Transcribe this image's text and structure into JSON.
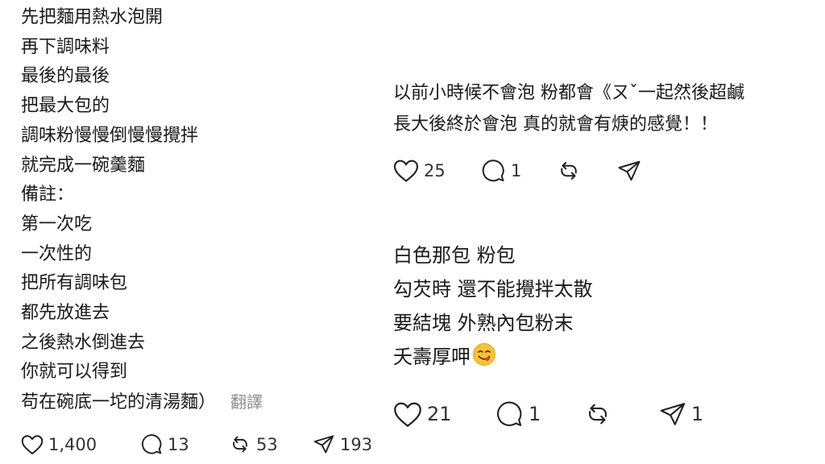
{
  "left_post": {
    "lines": [
      "先把麵用熱水泡開",
      "再下調味料",
      "最後的最後",
      "把最大包的",
      "調味粉慢慢倒慢慢攪拌",
      "就完成一碗羹麵",
      "備註：",
      "第一次吃",
      "一次性的",
      "把所有調味包",
      "都先放進去",
      "之後熱水倒進去",
      "你就可以得到",
      "苟在碗底一坨的清湯麵）"
    ],
    "translate_label": "翻譯",
    "likes": "1,400",
    "replies": "13",
    "reposts": "53",
    "shares": "193"
  },
  "reply1": {
    "lines": [
      "以前小時候不會泡 粉都會《ㄡˇ一起然後超鹹",
      "長大後終於會泡 真的就會有焿的感覺！！"
    ],
    "likes": "25",
    "replies": "1"
  },
  "reply2": {
    "lines": [
      "白色那包 粉包",
      "勾芡時 還不能攪拌太散",
      "要結塊 外熟內包粉末",
      "夭壽厚呷"
    ],
    "emoji": "yum-face-icon",
    "likes": "21",
    "replies": "1",
    "shares": "1"
  }
}
